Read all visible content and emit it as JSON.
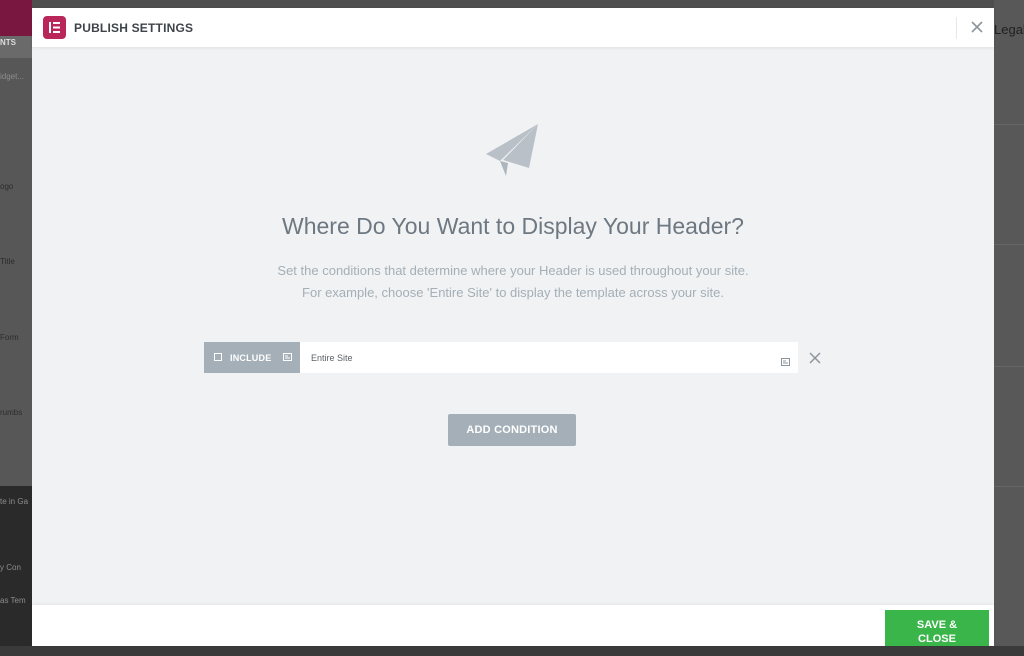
{
  "background": {
    "left_tab": "NTS",
    "left_search": "idget...",
    "left_items": [
      "ogo",
      "Title",
      "Form",
      "rumbs"
    ],
    "left_bottom_items": [
      "te in Ga",
      "",
      "y Con",
      "as Tem"
    ],
    "right_word": "Legal"
  },
  "modal": {
    "title": "PUBLISH SETTINGS",
    "heading": "Where Do You Want to Display Your Header?",
    "description_line1": "Set the conditions that determine where your Header is used throughout your site.",
    "description_line2": "For example, choose 'Entire Site' to display the template across your site.",
    "condition": {
      "type_label": "INCLUDE",
      "value_label": "Entire Site"
    },
    "add_condition_label": "ADD CONDITION",
    "save_label": "SAVE & CLOSE"
  },
  "colors": {
    "brand": "#b8265a",
    "select_gray": "#a4afb7",
    "save_green": "#39b54a"
  },
  "icons": {
    "logo": "elementor-logo-icon",
    "close": "close-icon",
    "illustration": "paper-plane-icon",
    "checkbox": "checkbox-icon",
    "dropdown": "dropdown-arrows-icon",
    "remove": "remove-condition-icon"
  }
}
